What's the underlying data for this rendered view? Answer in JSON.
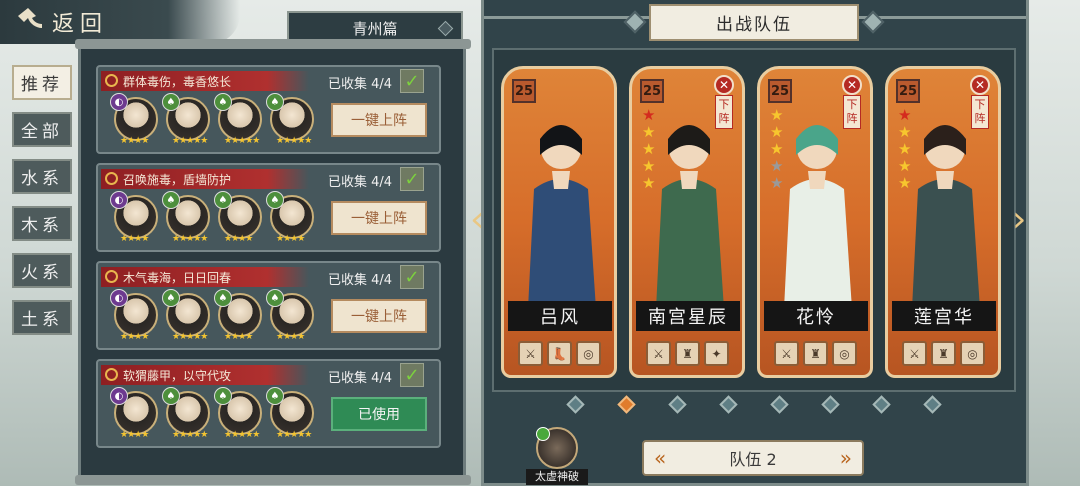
{
  "header": {
    "back_label": "返回",
    "chapter_label": "青州篇"
  },
  "tabs": [
    "推荐",
    "全部",
    "水系",
    "木系",
    "火系",
    "土系"
  ],
  "teams": [
    {
      "title": "群体毒伤，毒香悠长",
      "collected": "已收集 4/4",
      "button": "一键上阵",
      "members": [
        {
          "element": "purple",
          "stars": "★★★★"
        },
        {
          "element": "green",
          "stars": "★★★★★"
        },
        {
          "element": "green",
          "stars": "★★★★★"
        },
        {
          "element": "green",
          "stars": "★★★★★"
        }
      ]
    },
    {
      "title": "召唤施毒，盾墙防护",
      "collected": "已收集 4/4",
      "button": "一键上阵",
      "members": [
        {
          "element": "purple",
          "stars": "★★★★"
        },
        {
          "element": "green",
          "stars": "★★★★★"
        },
        {
          "element": "green",
          "stars": "★★★★"
        },
        {
          "element": "green",
          "stars": "★★★★"
        }
      ]
    },
    {
      "title": "木气毒海，日日回春",
      "collected": "已收集 4/4",
      "button": "一键上阵",
      "members": [
        {
          "element": "purple",
          "stars": "★★★★"
        },
        {
          "element": "green",
          "stars": "★★★★★"
        },
        {
          "element": "green",
          "stars": "★★★★"
        },
        {
          "element": "green",
          "stars": "★★★★"
        }
      ]
    },
    {
      "title": "软猬藤甲，以守代攻",
      "collected": "已收集 4/4",
      "button": "已使用",
      "members": [
        {
          "element": "purple",
          "stars": "★★★★"
        },
        {
          "element": "green",
          "stars": "★★★★★"
        },
        {
          "element": "green",
          "stars": "★★★★★"
        },
        {
          "element": "green",
          "stars": "★★★★★"
        }
      ]
    }
  ],
  "battle": {
    "title": "出战队伍",
    "heroes": [
      {
        "name": "吕风",
        "level": "25",
        "stars": [],
        "dismiss": "",
        "equip": [
          "⚔",
          "👢",
          "◎"
        ]
      },
      {
        "name": "南宫星辰",
        "level": "25",
        "stars": [
          "r",
          "y",
          "y",
          "y",
          "y"
        ],
        "dismiss": "下阵",
        "equip": [
          "⚔",
          "♜",
          "✦"
        ]
      },
      {
        "name": "花怜",
        "level": "25",
        "stars": [
          "y",
          "y",
          "y",
          "g",
          "g"
        ],
        "dismiss": "下阵",
        "equip": [
          "⚔",
          "♜",
          "◎"
        ]
      },
      {
        "name": "莲宫华",
        "level": "25",
        "stars": [
          "r",
          "y",
          "y",
          "y",
          "y"
        ],
        "dismiss": "下阵",
        "equip": [
          "⚔",
          "♜",
          "◎"
        ]
      }
    ],
    "page_dots": 8,
    "active_dot": 1,
    "team_label": "队伍 2",
    "skill_label": "太虚神破"
  },
  "colors": {
    "accent": "#d66d2a",
    "used_button": "#2f8b55",
    "title_red": "#b0302f"
  }
}
